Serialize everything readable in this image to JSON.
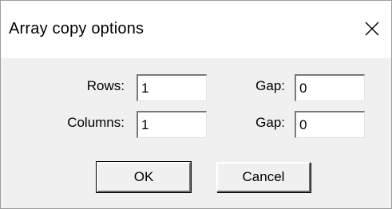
{
  "window": {
    "title": "Array copy options",
    "close_icon": "close-icon"
  },
  "form": {
    "rows_label": "Rows:",
    "rows_value": "1",
    "columns_label": "Columns:",
    "columns_value": "1",
    "row_gap_label": "Gap:",
    "row_gap_value": "0",
    "column_gap_label": "Gap:",
    "column_gap_value": "0"
  },
  "buttons": {
    "ok_label": "OK",
    "cancel_label": "Cancel"
  }
}
